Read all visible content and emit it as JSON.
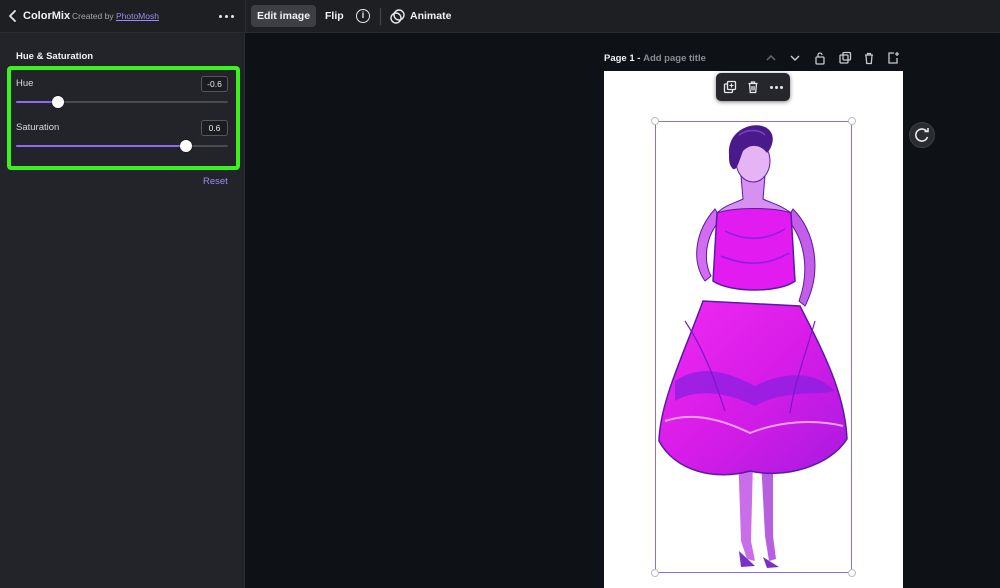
{
  "app": {
    "title": "ColorMix",
    "created_by_prefix": "Created by",
    "author": "PhotoMosh"
  },
  "toolbar": {
    "edit_image_label": "Edit image",
    "flip_label": "Flip",
    "info_glyph": "i",
    "animate_label": "Animate"
  },
  "panel": {
    "section_title": "Hue & Saturation",
    "sliders": [
      {
        "label": "Hue",
        "value": "-0.6",
        "fraction": 0.2
      },
      {
        "label": "Saturation",
        "value": "0.6",
        "fraction": 0.8
      }
    ],
    "reset_label": "Reset"
  },
  "page": {
    "label": "Page 1 -",
    "title_placeholder": "Add page title"
  },
  "colors": {
    "accent": "#8b6cf0",
    "highlight": "#3af21c",
    "dress": "#e81ff0",
    "dress_shadow": "#8a1fe0",
    "hair": "#4a1a8a"
  },
  "icons": {
    "back": "chevron-left-icon",
    "panel_more": "more-horizontal-icon",
    "info": "info-icon",
    "animate": "animate-icon",
    "page_up": "chevron-up-icon",
    "page_down": "chevron-down-icon",
    "lock": "lock-icon",
    "duplicate": "duplicate-icon",
    "delete": "trash-icon",
    "add_page": "add-page-icon",
    "rotate": "rotate-icon"
  }
}
